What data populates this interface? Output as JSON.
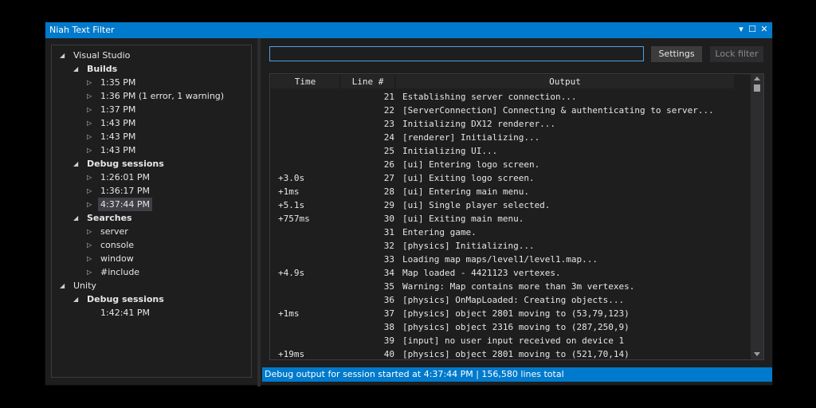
{
  "window": {
    "title": "Niah Text Filter"
  },
  "titlebar_buttons": {
    "menu": "▾",
    "maximize": "☐",
    "close": "✕"
  },
  "tree": [
    {
      "label": "Visual Studio",
      "arrow": "◢",
      "bold": false
    },
    {
      "label": "Builds",
      "arrow": "◢",
      "bold": true
    },
    {
      "label": "1:35 PM",
      "arrow": "▷",
      "bold": false
    },
    {
      "label": "1:36 PM (1 error, 1 warning)",
      "arrow": "▷",
      "bold": false
    },
    {
      "label": "1:37 PM",
      "arrow": "▷",
      "bold": false
    },
    {
      "label": "1:43 PM",
      "arrow": "▷",
      "bold": false
    },
    {
      "label": "1:43 PM",
      "arrow": "▷",
      "bold": false
    },
    {
      "label": "1:43 PM",
      "arrow": "▷",
      "bold": false
    },
    {
      "label": "Debug sessions",
      "arrow": "◢",
      "bold": true
    },
    {
      "label": "1:26:01 PM",
      "arrow": "▷",
      "bold": false
    },
    {
      "label": "1:36:17 PM",
      "arrow": "▷",
      "bold": false
    },
    {
      "label": "4:37:44 PM",
      "arrow": "▷",
      "bold": false,
      "selected": true
    },
    {
      "label": "Searches",
      "arrow": "◢",
      "bold": true
    },
    {
      "label": "server",
      "arrow": "▷",
      "bold": false
    },
    {
      "label": "console",
      "arrow": "▷",
      "bold": false
    },
    {
      "label": "window",
      "arrow": "▷",
      "bold": false
    },
    {
      "label": "#include",
      "arrow": "▷",
      "bold": false
    },
    {
      "label": "Unity",
      "arrow": "◢",
      "bold": false
    },
    {
      "label": "Debug sessions",
      "arrow": "◢",
      "bold": true
    },
    {
      "label": "1:42:41 PM",
      "arrow": "",
      "bold": false
    }
  ],
  "search": {
    "value": "",
    "placeholder": ""
  },
  "buttons": {
    "settings": "Settings",
    "lock_filter": "Lock filter"
  },
  "table": {
    "columns": {
      "time": "Time",
      "line": "Line #",
      "output": "Output"
    },
    "rows": [
      {
        "time": "",
        "line": "21",
        "output": "Establishing server connection..."
      },
      {
        "time": "",
        "line": "22",
        "output": "[ServerConnection] Connecting & authenticating to server..."
      },
      {
        "time": "",
        "line": "23",
        "output": "Initializing DX12 renderer..."
      },
      {
        "time": "",
        "line": "24",
        "output": "[renderer] Initializing..."
      },
      {
        "time": "",
        "line": "25",
        "output": "Initializing UI..."
      },
      {
        "time": "",
        "line": "26",
        "output": "[ui] Entering logo screen."
      },
      {
        "time": "+3.0s",
        "line": "27",
        "output": "[ui] Exiting logo screen."
      },
      {
        "time": "+1ms",
        "line": "28",
        "output": "[ui] Entering main menu."
      },
      {
        "time": "+5.1s",
        "line": "29",
        "output": "[ui] Single player selected."
      },
      {
        "time": "+757ms",
        "line": "30",
        "output": "[ui] Exiting main menu."
      },
      {
        "time": "",
        "line": "31",
        "output": "Entering game."
      },
      {
        "time": "",
        "line": "32",
        "output": "[physics] Initializing..."
      },
      {
        "time": "",
        "line": "33",
        "output": "Loading map maps/level1/level1.map..."
      },
      {
        "time": "+4.9s",
        "line": "34",
        "output": "Map loaded - 4421123 vertexes."
      },
      {
        "time": "",
        "line": "35",
        "output": "Warning: Map contains more than 3m vertexes."
      },
      {
        "time": "",
        "line": "36",
        "output": "[physics] OnMapLoaded: Creating objects..."
      },
      {
        "time": "+1ms",
        "line": "37",
        "output": "[physics] object 2801 moving to (53,79,123)"
      },
      {
        "time": "",
        "line": "38",
        "output": "[physics] object 2316 moving to (287,250,9)"
      },
      {
        "time": "",
        "line": "39",
        "output": "[input] no user input received on device 1"
      },
      {
        "time": "+19ms",
        "line": "40",
        "output": "[physics] object 2801 moving to (521,70,14)"
      }
    ]
  },
  "status": {
    "text": "Debug output for session started at 4:37:44 PM  |  156,580 lines total"
  },
  "colors": {
    "accent": "#007acc",
    "background": "#1e1e1e",
    "text": "#e6e6e6"
  }
}
